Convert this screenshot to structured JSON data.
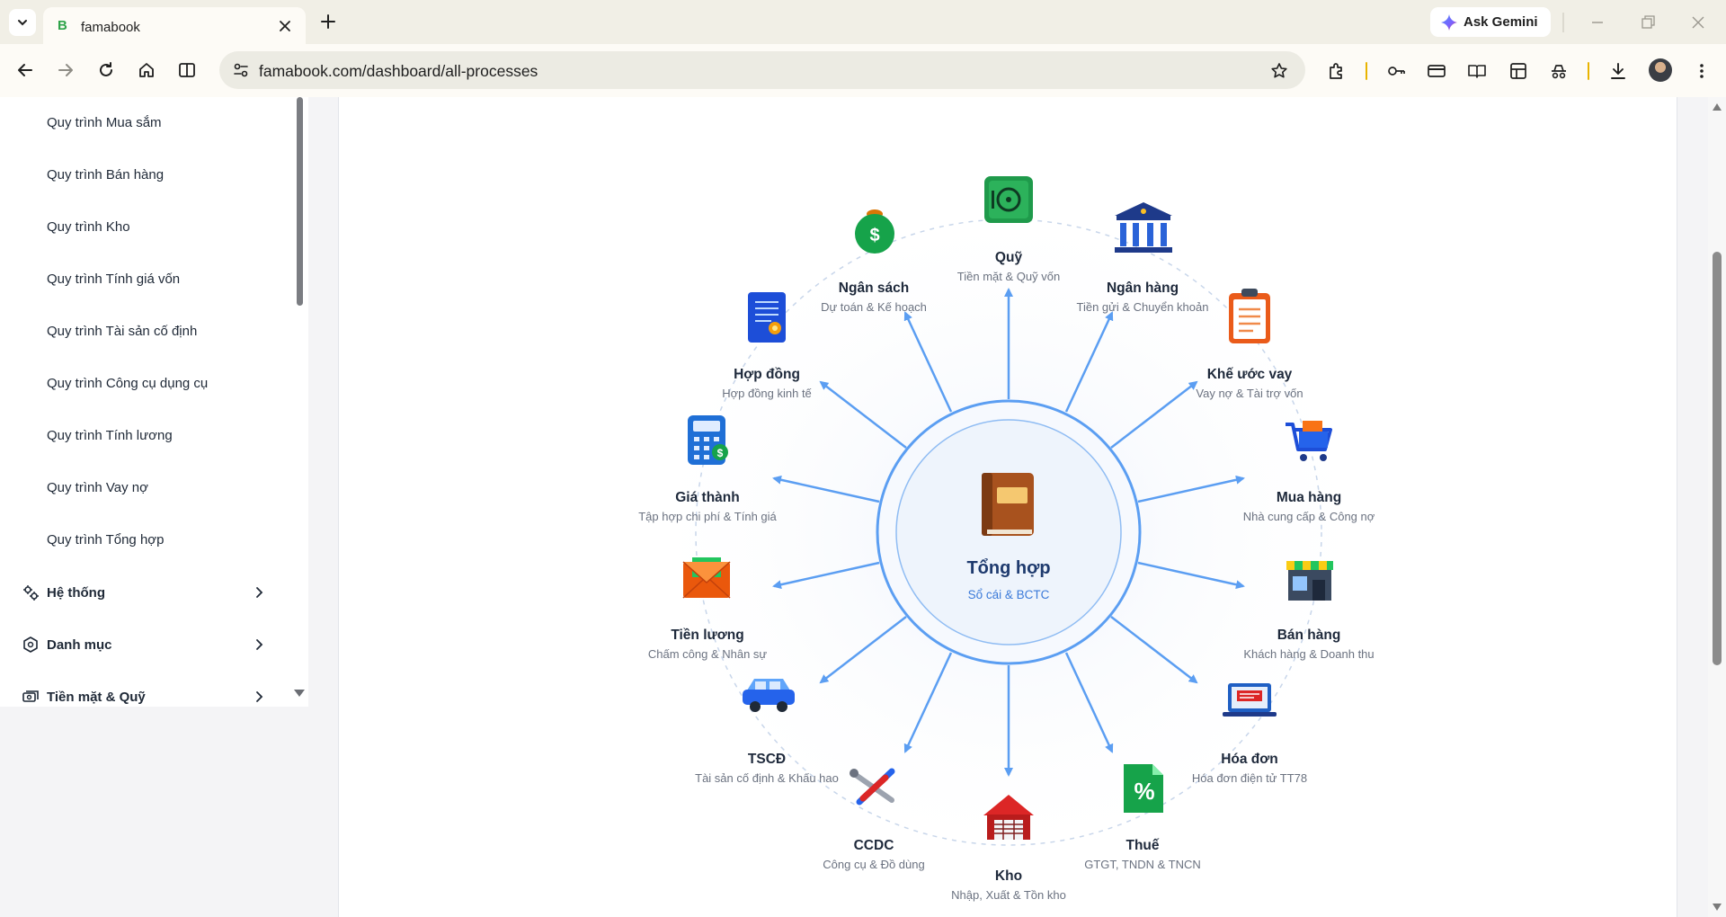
{
  "browser": {
    "tab_title": "famabook",
    "tab_favicon": "B",
    "url": "famabook.com/dashboard/all-processes",
    "gemini_label": "Ask Gemini"
  },
  "sidebar": {
    "items": [
      {
        "label": "Quy trình Mua sắm"
      },
      {
        "label": "Quy trình Bán hàng"
      },
      {
        "label": "Quy trình Kho"
      },
      {
        "label": "Quy trình Tính giá vốn"
      },
      {
        "label": "Quy trình Tài sản cố định"
      },
      {
        "label": "Quy trình Công cụ dụng cụ"
      },
      {
        "label": "Quy trình Tính lương"
      },
      {
        "label": "Quy trình Vay nợ"
      },
      {
        "label": "Quy trình Tổng hợp"
      }
    ],
    "groups": [
      {
        "label": "Hệ thống",
        "icon": "gear-group-icon"
      },
      {
        "label": "Danh mục",
        "icon": "hexagon-icon"
      },
      {
        "label": "Tiền mặt & Quỹ",
        "icon": "cash-icon"
      }
    ]
  },
  "diagram": {
    "center": {
      "title": "Tổng hợp",
      "subtitle": "Sổ cái & BCTC",
      "icon": "ledger-book-icon"
    },
    "nodes": [
      {
        "key": "quy",
        "label": "Quỹ",
        "sub": "Tiền mặt & Quỹ vốn",
        "icon": "safe-icon"
      },
      {
        "key": "ngan-hang",
        "label": "Ngân hàng",
        "sub": "Tiền gửi & Chuyển khoản",
        "icon": "bank-icon"
      },
      {
        "key": "khe-uoc-vay",
        "label": "Khế ước vay",
        "sub": "Vay nợ & Tài trợ vốn",
        "icon": "clipboard-icon"
      },
      {
        "key": "mua-hang",
        "label": "Mua hàng",
        "sub": "Nhà cung cấp & Công nợ",
        "icon": "cart-icon"
      },
      {
        "key": "ban-hang",
        "label": "Bán hàng",
        "sub": "Khách hàng & Doanh thu",
        "icon": "store-icon"
      },
      {
        "key": "hoa-don",
        "label": "Hóa đơn",
        "sub": "Hóa đơn điện tử TT78",
        "icon": "laptop-icon"
      },
      {
        "key": "thue",
        "label": "Thuế",
        "sub": "GTGT, TNDN & TNCN",
        "icon": "percent-doc-icon"
      },
      {
        "key": "kho",
        "label": "Kho",
        "sub": "Nhập, Xuất & Tồn kho",
        "icon": "warehouse-icon"
      },
      {
        "key": "ccdc",
        "label": "CCDC",
        "sub": "Công cụ & Đồ dùng",
        "icon": "tools-icon"
      },
      {
        "key": "tscd",
        "label": "TSCĐ",
        "sub": "Tài sản cố định & Khấu hao",
        "icon": "car-icon"
      },
      {
        "key": "tien-luong",
        "label": "Tiền lương",
        "sub": "Chấm công & Nhân sự",
        "icon": "envelope-icon"
      },
      {
        "key": "gia-thanh",
        "label": "Giá thành",
        "sub": "Tập hợp chi phí & Tính giá",
        "icon": "calculator-icon"
      },
      {
        "key": "hop-dong",
        "label": "Hợp đồng",
        "sub": "Hợp đồng kinh tế",
        "icon": "contract-icon"
      },
      {
        "key": "ngan-sach",
        "label": "Ngân sách",
        "sub": "Dự toán & Kế hoạch",
        "icon": "money-bag-icon"
      }
    ]
  }
}
